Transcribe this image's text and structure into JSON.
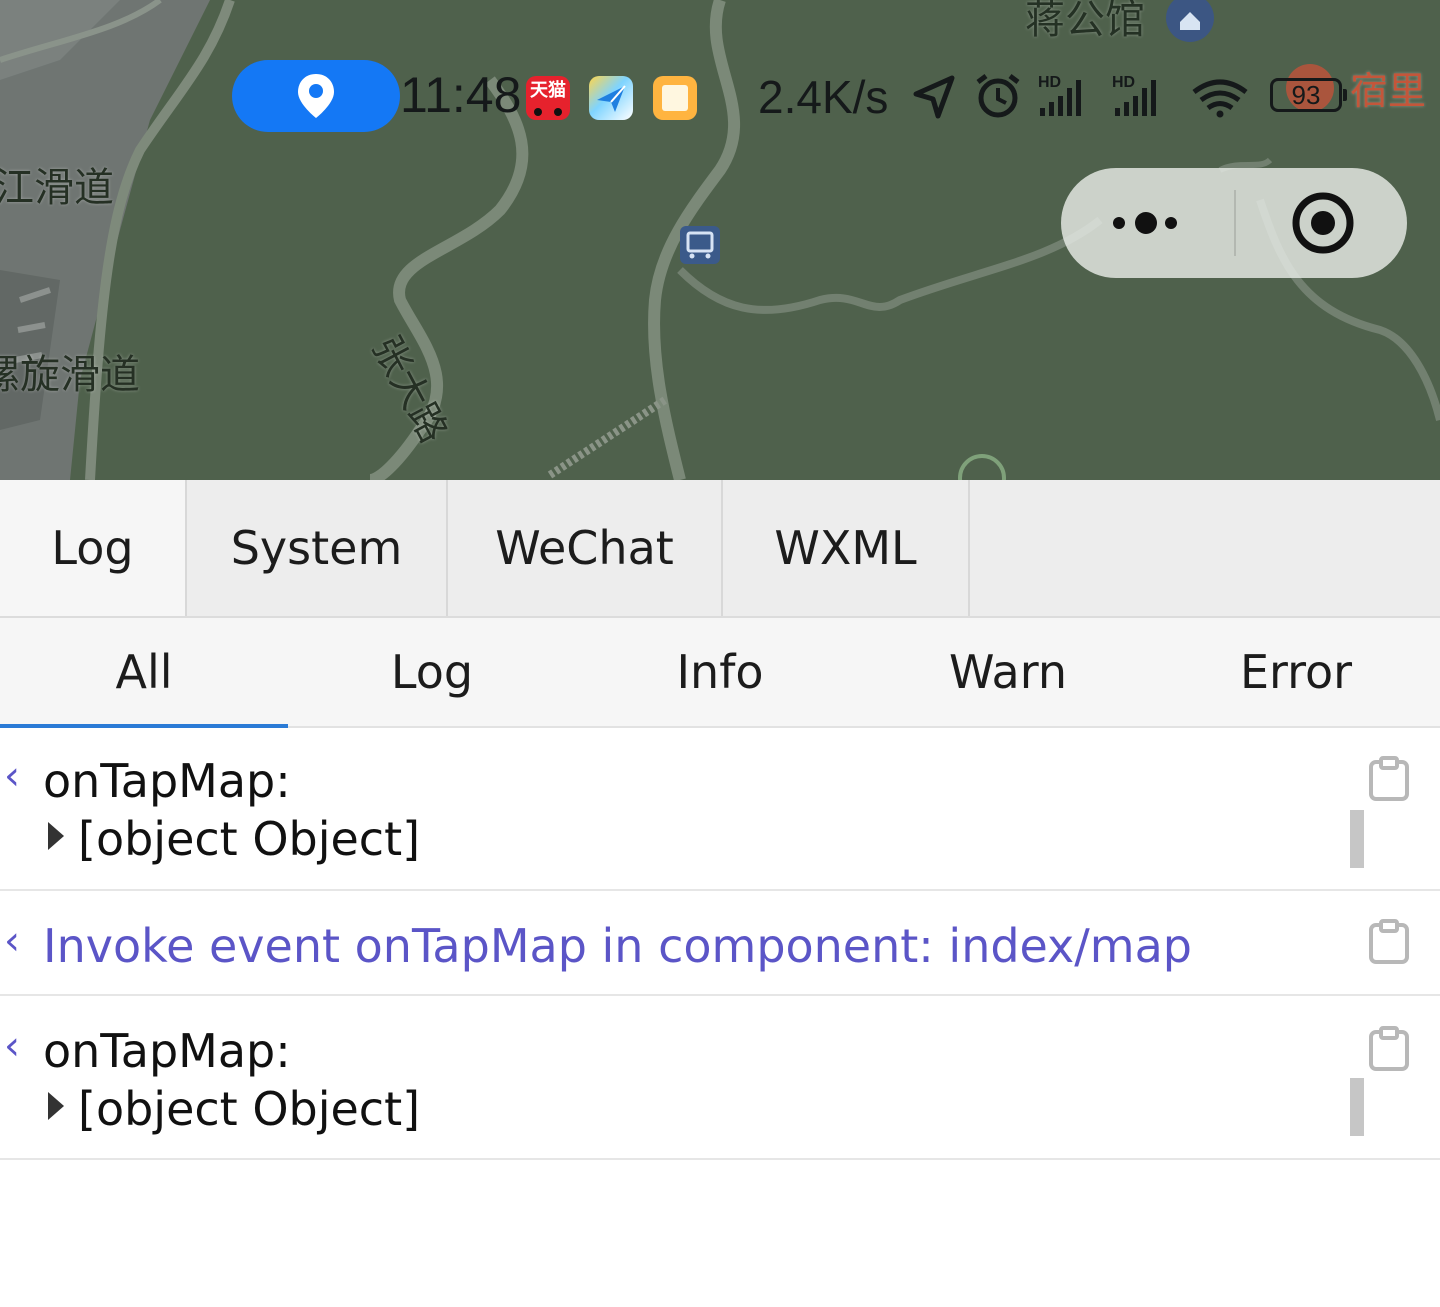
{
  "map": {
    "labels": {
      "top_poi": "蒋公馆",
      "right_poi": "宿里",
      "slide_lane": "江滑道",
      "spiral_lane": "螺旋滑道",
      "road": "张大路"
    }
  },
  "status_bar": {
    "time": "11:48",
    "network_speed": "2.4K/s",
    "battery_level": "93",
    "tmall_icon_text": "天猫",
    "signal_tag_1": "HD",
    "signal_tag_2": "HD",
    "icons": [
      "location-pill-icon",
      "tmall-app-icon",
      "flyer-app-icon",
      "notes-app-icon",
      "navigation-arrow-icon",
      "alarm-icon",
      "signal-icon",
      "signal-icon",
      "wifi-icon",
      "battery-icon"
    ]
  },
  "capsule": {
    "more_icon": "more-dots-icon",
    "close_icon": "target-circle-icon"
  },
  "vconsole": {
    "tabs": [
      {
        "label": "Log",
        "active": true
      },
      {
        "label": "System",
        "active": false
      },
      {
        "label": "WeChat",
        "active": false
      },
      {
        "label": "WXML",
        "active": false
      }
    ],
    "filters": [
      {
        "label": "All",
        "active": true
      },
      {
        "label": "Log",
        "active": false
      },
      {
        "label": "Info",
        "active": false
      },
      {
        "label": "Warn",
        "active": false
      },
      {
        "label": "Error",
        "active": false
      }
    ],
    "logs": [
      {
        "arrow": "‹",
        "line1": "onTapMap:",
        "line2": "[object Object]",
        "type": "log"
      },
      {
        "arrow": "‹",
        "line1": "Invoke event onTapMap in component: index/map",
        "type": "info"
      },
      {
        "arrow": "‹",
        "line1": "onTapMap:",
        "line2": "[object Object]",
        "type": "log"
      }
    ]
  },
  "colors": {
    "map_green": "#4f614c",
    "accent_blue": "#2b7bd6",
    "location_pill": "#1478f5",
    "info_purple": "#5b55c7"
  }
}
